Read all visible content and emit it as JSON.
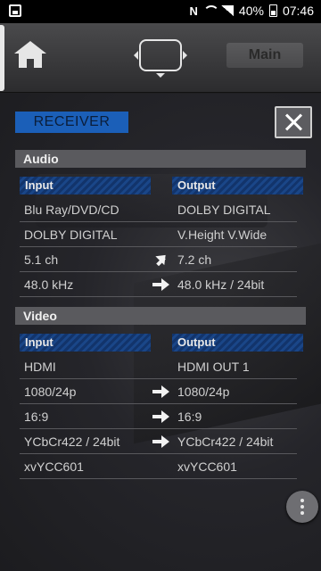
{
  "status_bar": {
    "notification_icon": "image-icon",
    "nfc_label": "N",
    "battery_percent": "40%",
    "time": "07:46"
  },
  "nav": {
    "home_icon": "home-icon",
    "center_icon": "zone-select-icon",
    "main_label": "Main"
  },
  "panel": {
    "title": "RECEIVER",
    "close_icon": "close-icon",
    "audio": {
      "heading": "Audio",
      "input_label": "Input",
      "output_label": "Output",
      "rows": [
        {
          "input": "Blu Ray/DVD/CD",
          "output": "DOLBY DIGITAL",
          "arrow": "none"
        },
        {
          "input": "DOLBY DIGITAL",
          "output": "V.Height V.Wide",
          "arrow": "none"
        },
        {
          "input": "5.1 ch",
          "output": "7.2 ch",
          "arrow": "up"
        },
        {
          "input": "48.0 kHz",
          "output": "48.0 kHz / 24bit",
          "arrow": "right"
        }
      ]
    },
    "video": {
      "heading": "Video",
      "input_label": "Input",
      "output_label": "Output",
      "rows": [
        {
          "input": "HDMI",
          "output": "HDMI OUT 1",
          "arrow": "none"
        },
        {
          "input": "1080/24p",
          "output": "1080/24p",
          "arrow": "right"
        },
        {
          "input": "16:9",
          "output": "16:9",
          "arrow": "right"
        },
        {
          "input": "YCbCr422 / 24bit",
          "output": "YCbCr422 / 24bit",
          "arrow": "right"
        },
        {
          "input": "xvYCC601",
          "output": "xvYCC601",
          "arrow": "none"
        }
      ]
    },
    "more_icon": "more-vertical-icon"
  },
  "colors": {
    "accent": "#1b5fb8",
    "header_stripe": "#12346b",
    "section_bg": "#5a5a5e"
  }
}
